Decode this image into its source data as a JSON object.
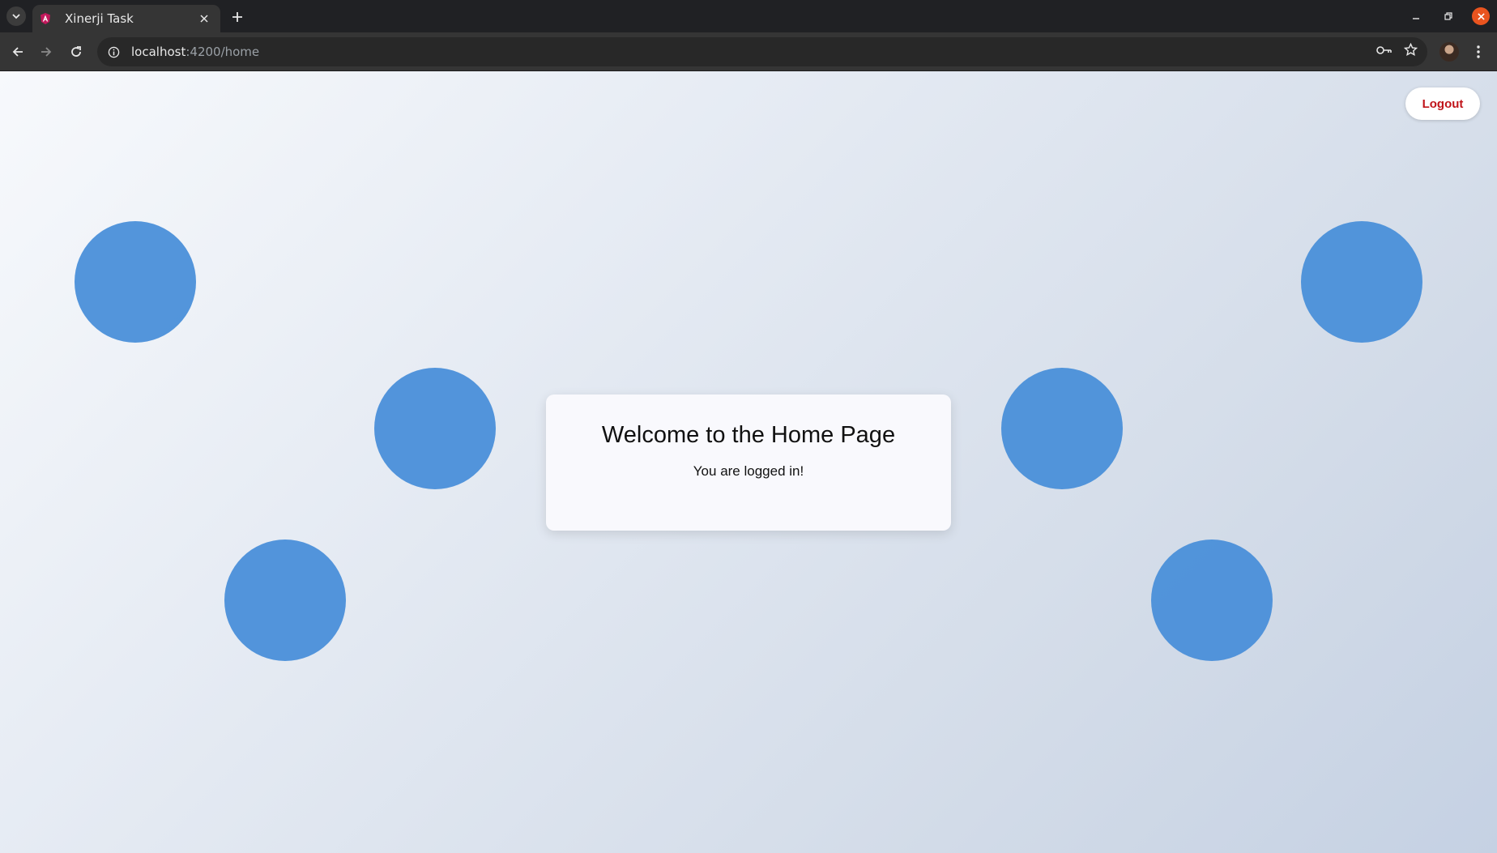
{
  "browser": {
    "tab": {
      "title": "Xinerji Task"
    },
    "address_bar": {
      "host": "localhost",
      "path": ":4200/home"
    }
  },
  "page": {
    "logout_label": "Logout",
    "card": {
      "heading": "Welcome to the Home Page",
      "message": "You are logged in!"
    }
  },
  "colors": {
    "circle": "#4a8fd9",
    "logout_text": "#c0141a",
    "card_bg": "#f9f9fd"
  }
}
